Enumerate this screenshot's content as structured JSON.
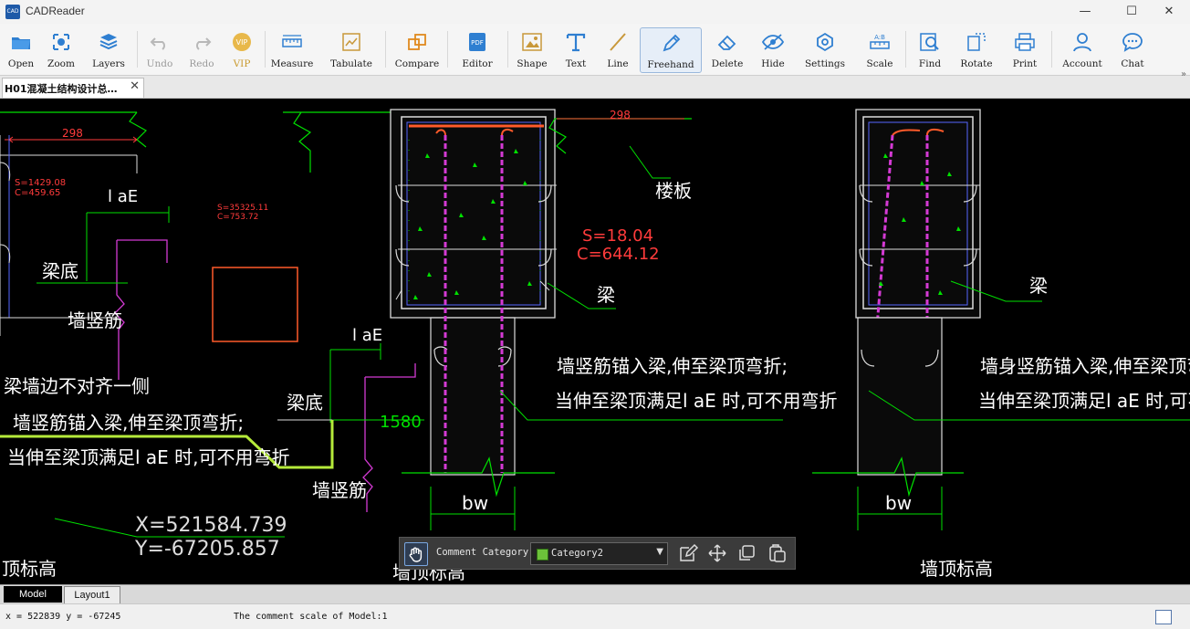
{
  "window": {
    "title": "CADReader",
    "logo_text": "CAD",
    "minimize": "—",
    "maximize": "☐",
    "close": "✕"
  },
  "toolbar": {
    "open": "Open",
    "zoom": "Zoom",
    "layers": "Layers",
    "undo": "Undo",
    "redo": "Redo",
    "vip": "VIP",
    "measure": "Measure",
    "tabulate": "Tabulate",
    "compare": "Compare",
    "editor": "Editor",
    "shape": "Shape",
    "text": "Text",
    "line": "Line",
    "freehand": "Freehand",
    "delete": "Delete",
    "hide": "Hide",
    "settings": "Settings",
    "scale": "Scale",
    "find": "Find",
    "rotate": "Rotate",
    "print": "Print",
    "account": "Account",
    "chat": "Chat",
    "more": "»"
  },
  "tabs": {
    "doc_title": "H01混凝土结构设计总…",
    "close": "✕"
  },
  "drawing": {
    "dim_298": "298",
    "s1": "S=1429.08",
    "c1": "C=459.65",
    "lae": "l aE",
    "s2": "S=35325.11",
    "c2": "C=753.72",
    "beam_bottom": "梁底",
    "wall_rebar": "墙竖筋",
    "floor_slab": "楼板",
    "s3": "S=18.04",
    "c3": "C=644.12",
    "beam": "梁",
    "note_a1": "墙竖筋锚入梁,伸至梁顶弯折;",
    "note_a2": "当伸至梁顶满足l aE 时,可不用弯折",
    "note_b1": "墙身竖筋锚入梁,伸至梁顶弯折;",
    "note_b2": "当伸至梁顶满足l aE 时,可不用弯折",
    "note_c0": "梁墙边不对齐一侧",
    "note_c1": "墙竖筋锚入梁,伸至梁顶弯折;",
    "note_c2": "当伸至梁顶满足l aE 时,可不用弯折",
    "dim_1580": "1580",
    "bw": "bw",
    "x_coord": "X=521584.739",
    "y_coord": "Y=-67205.857",
    "top_elev": "顶标高",
    "wall_top_elev": "墙顶标高"
  },
  "comment_toolbar": {
    "category_label": "Comment Category",
    "category_value": "Category2",
    "category_color": "#6cc13a"
  },
  "layout_tabs": {
    "model": "Model",
    "layout1": "Layout1"
  },
  "status": {
    "coords": "x = 522839 y = -67245",
    "scale_msg": "The comment scale of Model:1"
  }
}
